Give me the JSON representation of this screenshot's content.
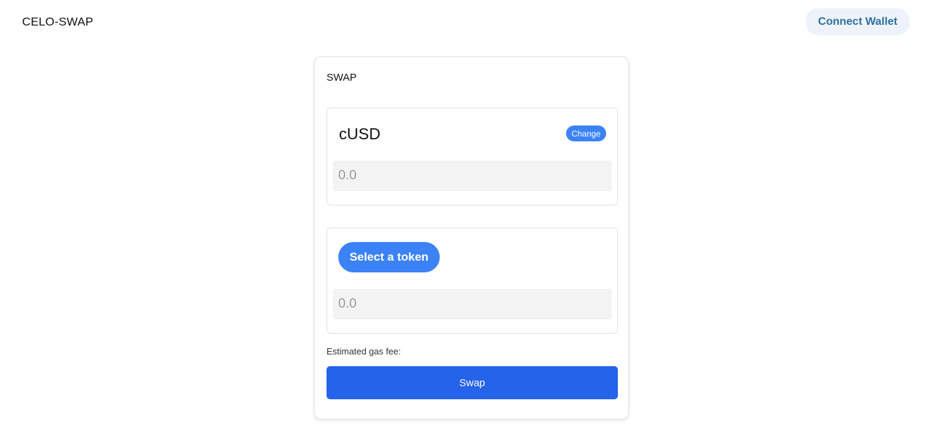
{
  "header": {
    "brand": "CELO-SWAP",
    "connect_wallet_label": "Connect Wallet"
  },
  "swap_card": {
    "title": "SWAP",
    "from": {
      "token": "cUSD",
      "change_label": "Change",
      "amount_placeholder": "0.0"
    },
    "to": {
      "select_token_label": "Select a token",
      "amount_placeholder": "0.0"
    },
    "gas_fee_label": "Estimated gas fee:",
    "swap_label": "Swap"
  },
  "colors": {
    "primary": "#2563eb",
    "accent": "#3b82f6",
    "connect_bg": "#eef3fb",
    "connect_text": "#2f6f9f"
  }
}
